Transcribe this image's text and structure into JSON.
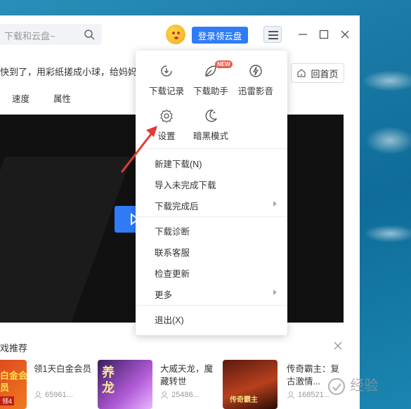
{
  "search": {
    "placeholder": "下载和云盘~",
    "icon": "search-icon"
  },
  "header": {
    "login_label": "登录领云盘"
  },
  "notice": {
    "text": "快到了，用彩纸搓成小球，给妈妈做一"
  },
  "home_button": {
    "label": "回首页"
  },
  "tabs": [
    "速度",
    "属性"
  ],
  "recommend": {
    "title": "戏推荐",
    "cards": [
      {
        "title": "领1天白金会员",
        "count": "65961...",
        "thumb_text": "白金会员",
        "thumb_badge": "领4"
      },
      {
        "title": "大威天龙，魔藏转世",
        "count": "25486...",
        "thumb_text": "养龙"
      },
      {
        "title": "传奇霸主：复古激情...",
        "count": "168521...",
        "thumb_text": "传奇霸主"
      }
    ]
  },
  "menu": {
    "tiles": [
      {
        "label": "下载记录",
        "icon": "clock-download-icon"
      },
      {
        "label": "下载助手",
        "icon": "leaf-assistant-icon",
        "badge": "NEW"
      },
      {
        "label": "迅雷影音",
        "icon": "thunder-player-icon"
      },
      {
        "label": "设置",
        "icon": "gear-icon"
      },
      {
        "label": "暗黑模式",
        "icon": "moon-icon"
      }
    ],
    "items": [
      {
        "label": "新建下载(N)"
      },
      {
        "label": "导入未完成下载"
      },
      {
        "label": "下载完成后",
        "submenu": true
      },
      {
        "label": "下载诊断"
      },
      {
        "label": "联系客服"
      },
      {
        "label": "检查更新"
      },
      {
        "label": "更多",
        "submenu": true
      },
      {
        "label": "退出(X)"
      }
    ]
  },
  "watermark": {
    "text": "经验"
  },
  "colors": {
    "accent": "#2f7cf6",
    "annotation": "#e53935",
    "badge": "#f25a4a"
  }
}
